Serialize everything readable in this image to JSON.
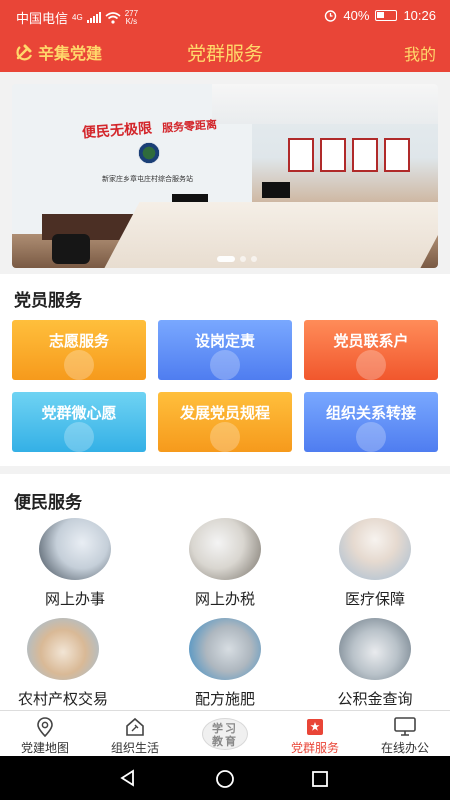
{
  "status_bar": {
    "carrier": "中国电信",
    "network": "4G",
    "speed_value": "277",
    "speed_unit": "K/s",
    "battery": "40%",
    "time": "10:26"
  },
  "app_bar": {
    "brand": "辛集党建",
    "title": "党群服务",
    "mine": "我的"
  },
  "banner": {
    "slogan_left": "便民无极限",
    "slogan_right": "服务零距离",
    "sign": "新家庄乡章屯庄村综合服务站",
    "slide_count": 3,
    "active_slide": 1
  },
  "party_services": {
    "title": "党员服务",
    "items": [
      {
        "label": "志愿服务",
        "color": "orange"
      },
      {
        "label": "设岗定责",
        "color": "blue"
      },
      {
        "label": "党员联系户",
        "color": "red"
      },
      {
        "label": "党群微心愿",
        "color": "cyan"
      },
      {
        "label": "发展党员规程",
        "color": "orange"
      },
      {
        "label": "组织关系转接",
        "color": "blue"
      }
    ]
  },
  "public_services": {
    "title": "便民服务",
    "items": [
      {
        "label": "网上办事",
        "icon": "laptop-photo"
      },
      {
        "label": "网上办税",
        "icon": "calculator-photo"
      },
      {
        "label": "医疗保障",
        "icon": "doctors-photo"
      },
      {
        "label": "农村产权交易",
        "icon": "house-blocks-photo"
      },
      {
        "label": "配方施肥",
        "icon": "fertilizer-photo"
      },
      {
        "label": "公积金查询",
        "icon": "coins-photo"
      }
    ]
  },
  "tab_bar": {
    "items": [
      {
        "label": "党建地图",
        "icon": "map-pin-icon"
      },
      {
        "label": "组织生活",
        "icon": "party-house-icon"
      },
      {
        "label": "学习教育",
        "icon": "study-badge"
      },
      {
        "label": "党群服务",
        "icon": "party-flag-icon"
      },
      {
        "label": "在线办公",
        "icon": "monitor-icon"
      }
    ],
    "active_index": 3
  },
  "colors": {
    "primary": "#e94537",
    "brand_gold": "#ffd86b"
  }
}
